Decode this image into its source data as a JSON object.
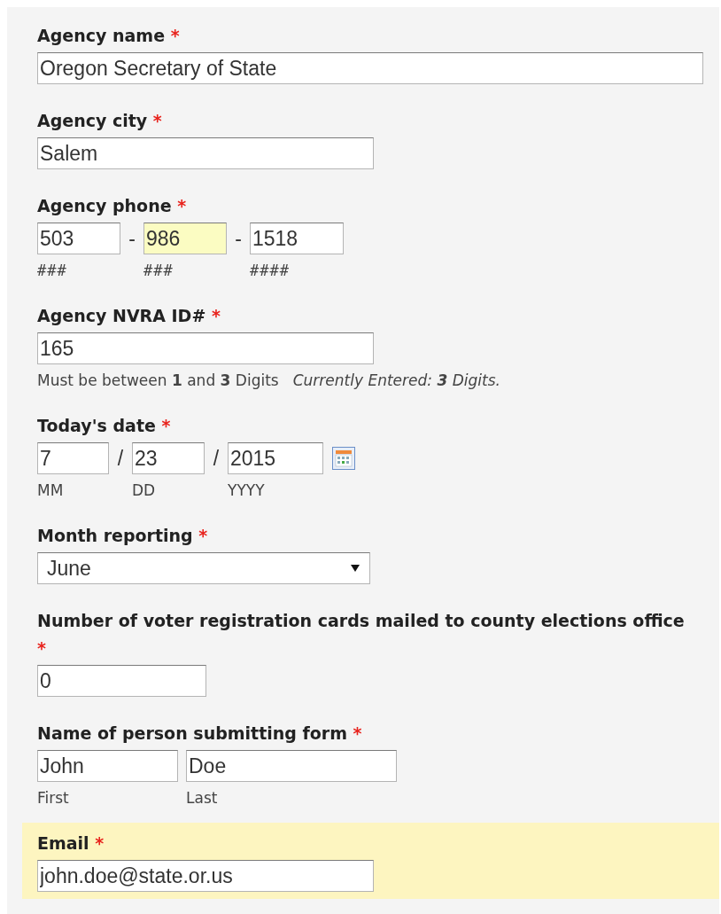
{
  "fields": [
    {
      "kind": "wide-text",
      "label": "Agency name",
      "required_mark": "*",
      "highlighted": false,
      "value": "Oregon Secretary of State"
    },
    {
      "kind": "text",
      "label": "Agency city",
      "required_mark": "*",
      "highlighted": false,
      "value": "Salem"
    },
    {
      "kind": "phone",
      "label": "Agency phone",
      "required_mark": "*",
      "highlighted": false,
      "parts": [
        {
          "value": "503",
          "hint": "###",
          "focused": false
        },
        {
          "separator": "-",
          "value": "986",
          "hint": "###",
          "focused": true
        },
        {
          "separator": "-",
          "value": "1518",
          "hint": "####",
          "focused": false
        }
      ]
    },
    {
      "kind": "text",
      "label": "Agency NVRA ID#",
      "required_mark": "*",
      "highlighted": false,
      "value": "165",
      "help": "Must be between **1** and **3** Digits",
      "status": "Currently Entered: **3** Digits."
    },
    {
      "kind": "date",
      "label": "Today's date",
      "required_mark": "*",
      "highlighted": false,
      "parts": [
        {
          "value": "7",
          "hint": "MM",
          "focused": false
        },
        {
          "separator": "/",
          "value": "23",
          "hint": "DD",
          "focused": false
        },
        {
          "separator": "/",
          "value": "2015",
          "hint": "YYYY",
          "focused": false
        }
      ]
    },
    {
      "kind": "select",
      "label": "Month reporting",
      "required_mark": "*",
      "highlighted": false,
      "value": "June"
    },
    {
      "kind": "short-text",
      "label": "Number of voter registration cards mailed to county elections office",
      "required_mark": "*",
      "highlighted": false,
      "value": "0"
    },
    {
      "kind": "name",
      "label": "Name of person submitting form",
      "required_mark": "*",
      "highlighted": false,
      "parts": [
        {
          "value": "John",
          "hint": "First",
          "focused": false
        },
        {
          "value": "Doe",
          "hint": "Last",
          "focused": false
        }
      ]
    },
    {
      "kind": "text",
      "label": "Email",
      "required_mark": "*",
      "highlighted": true,
      "value": "john.doe@state.or.us"
    }
  ]
}
